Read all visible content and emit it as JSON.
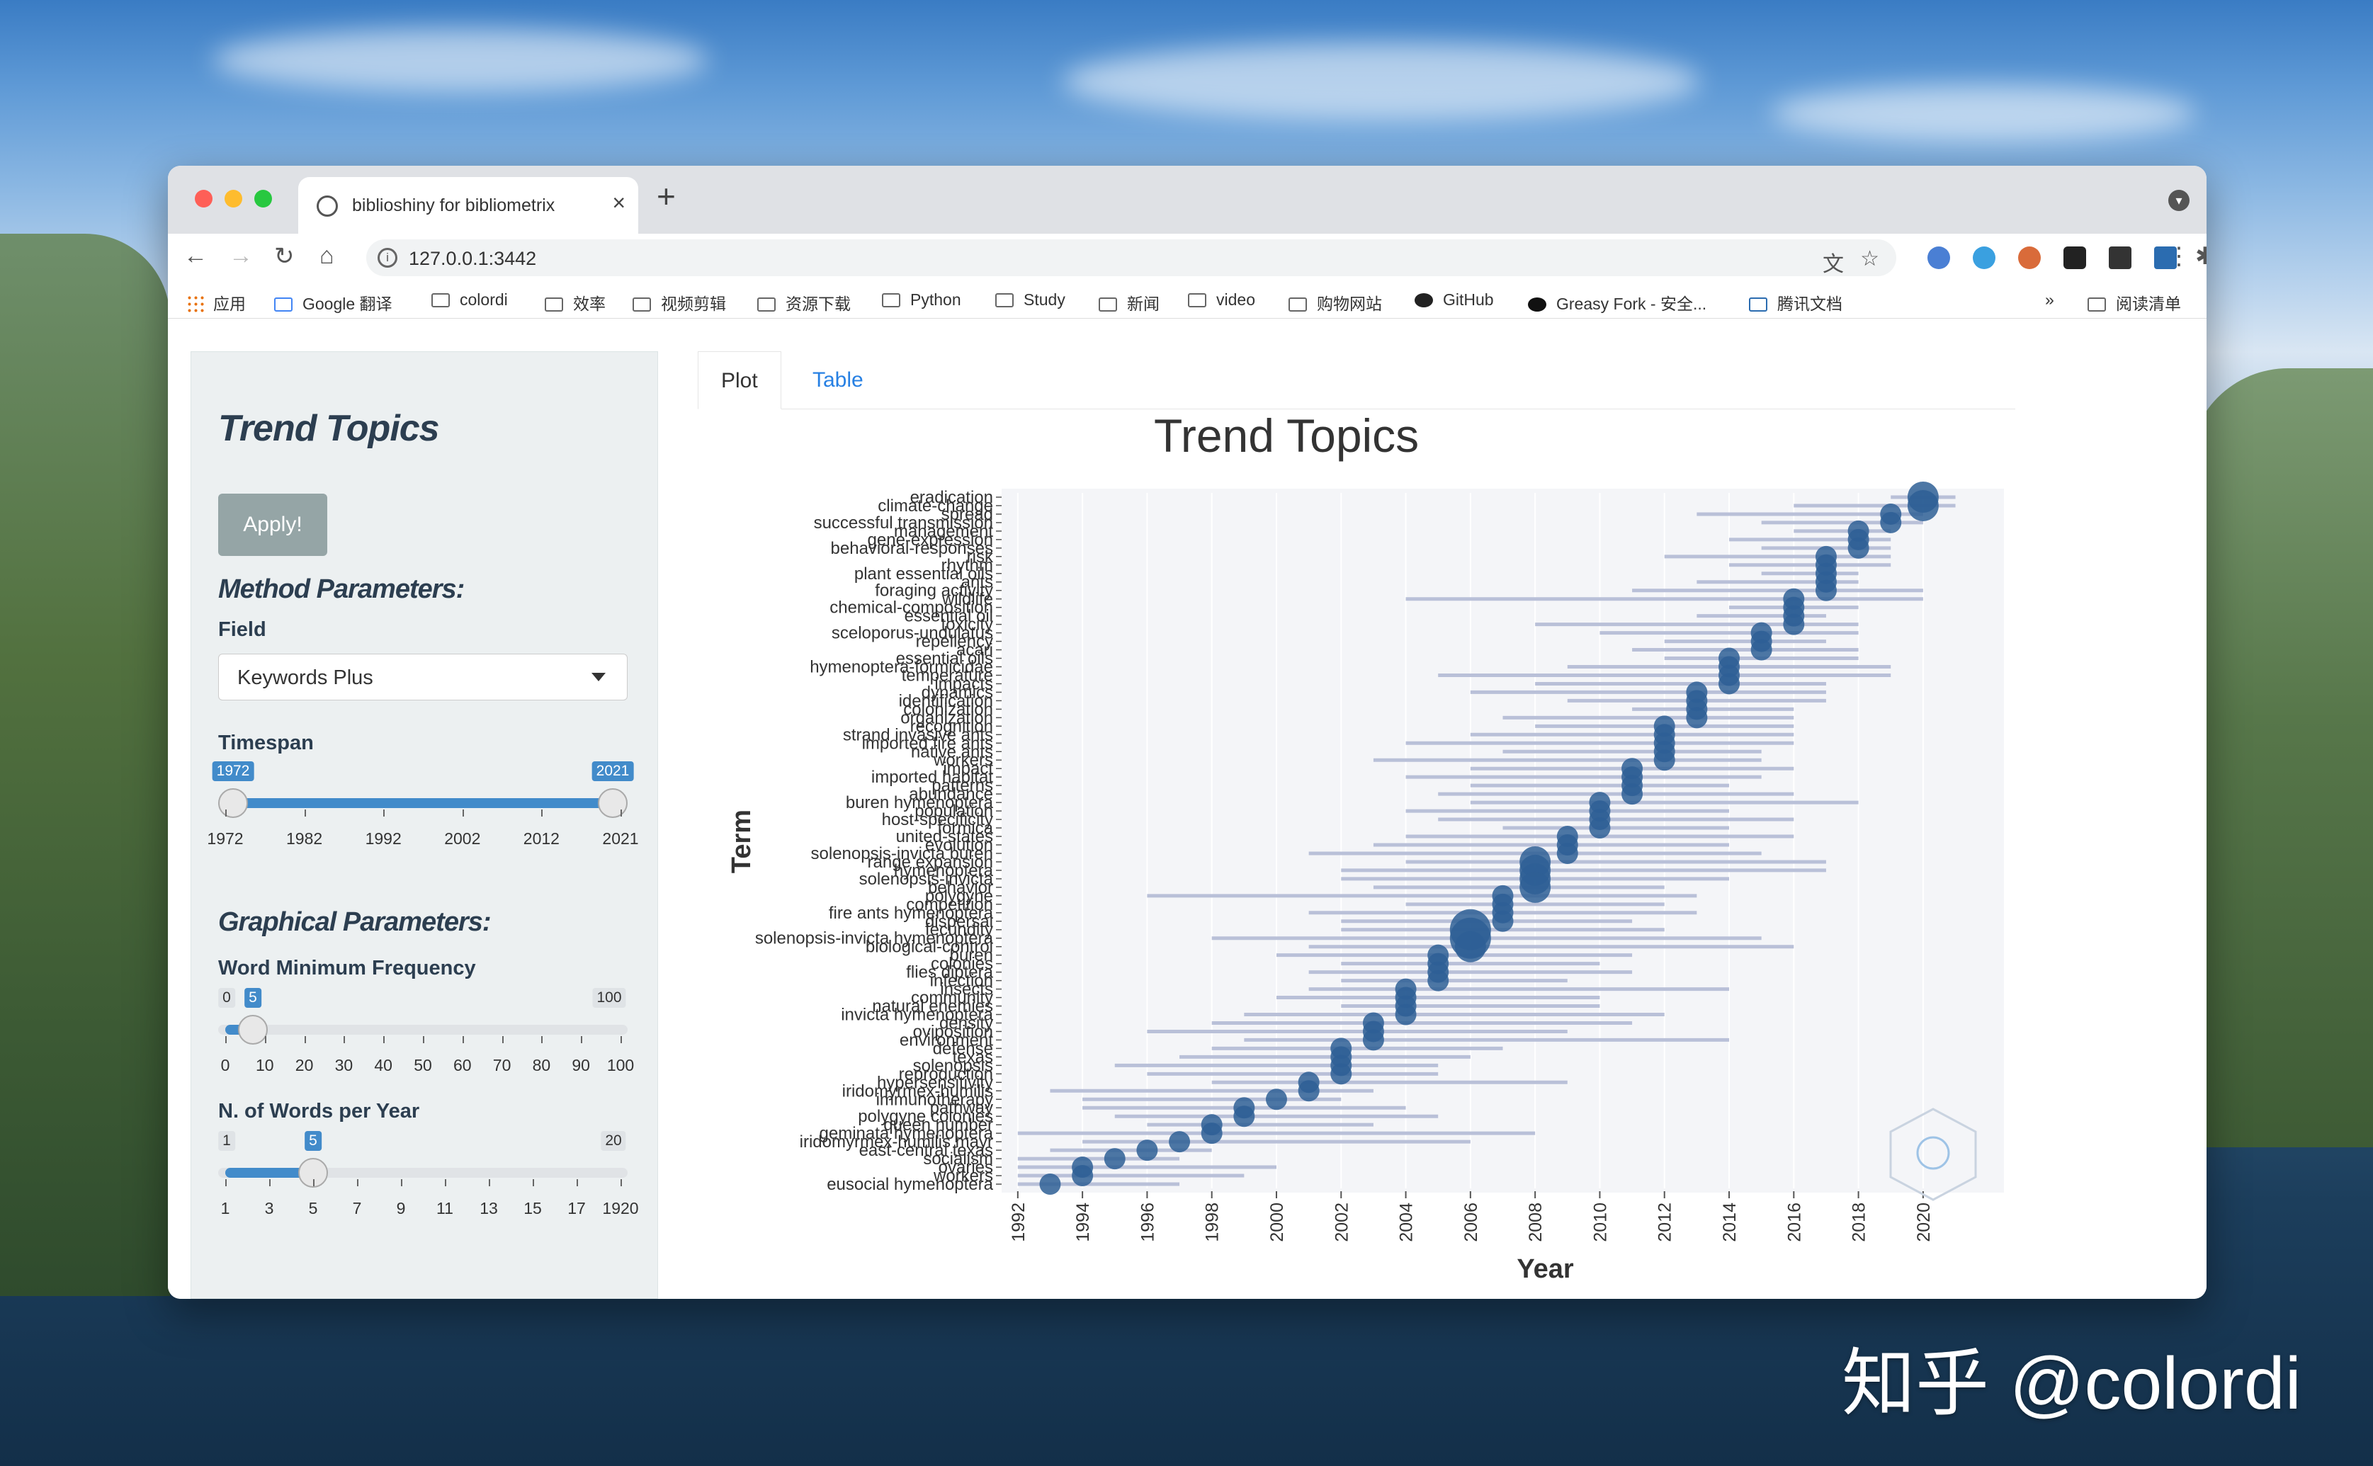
{
  "browser": {
    "tab_title": "biblioshiny for bibliometrix",
    "tab_close": "×",
    "new_tab": "+",
    "url": "127.0.0.1:3442",
    "nav": {
      "back": "←",
      "forward": "→",
      "reload": "↻",
      "home": "⌂",
      "info": "i",
      "translate": "文",
      "star": "☆",
      "puzzle": "✱",
      "kebab": "⋮"
    },
    "bookmarks": [
      "应用",
      "Google 翻译",
      "colordi",
      "效率",
      "视频剪辑",
      "资源下载",
      "Python",
      "Study",
      "新闻",
      "video",
      "购物网站",
      "GitHub",
      "Greasy Fork - 安全...",
      "腾讯文档"
    ],
    "more": "»",
    "reading_list": "阅读清单"
  },
  "sidebar": {
    "title": "Trend Topics",
    "apply": "Apply!",
    "method_title": "Method Parameters:",
    "field_label": "Field",
    "field_value": "Keywords Plus",
    "timespan_label": "Timespan",
    "timespan": {
      "min": 1972,
      "max": 2021,
      "from": "1972",
      "to": "2021",
      "ticks": [
        "1972",
        "1982",
        "1992",
        "2002",
        "2012",
        "2021"
      ]
    },
    "graphical_title": "Graphical Parameters:",
    "minfreq_label": "Word Minimum Frequency",
    "minfreq": {
      "min": "0",
      "max": "100",
      "value": "5",
      "ticks": [
        "0",
        "10",
        "20",
        "30",
        "40",
        "50",
        "60",
        "70",
        "80",
        "90",
        "100"
      ]
    },
    "words_label": "N. of Words per Year",
    "words": {
      "min": "1",
      "max": "20",
      "value": "5",
      "ticks": [
        "1",
        "3",
        "5",
        "7",
        "9",
        "11",
        "13",
        "15",
        "17",
        "1920"
      ]
    }
  },
  "tabs": {
    "plot": "Plot",
    "table": "Table"
  },
  "watermark": "知乎 @colordi",
  "chart_data": {
    "type": "scatter",
    "title": "Trend Topics",
    "xlabel": "Year",
    "ylabel": "Term",
    "xlim": [
      1991.5,
      2022.5
    ],
    "x_ticks": [
      "1992",
      "1994",
      "1996",
      "1998",
      "2000",
      "2002",
      "2004",
      "2006",
      "2008",
      "2010",
      "2012",
      "2014",
      "2016",
      "2018",
      "2020"
    ],
    "colors": {
      "point": "#2e5f95",
      "range": "#b9c0d8",
      "band": "#f4f5f8"
    },
    "terms": [
      {
        "term": "eradication",
        "median": 2020,
        "q1": 2019,
        "q3": 2021,
        "size": 2
      },
      {
        "term": "climate-change",
        "median": 2020,
        "q1": 2016,
        "q3": 2021,
        "size": 2
      },
      {
        "term": "spread",
        "median": 2019,
        "q1": 2013,
        "q3": 2020,
        "size": 1
      },
      {
        "term": "successful transmission",
        "median": 2019,
        "q1": 2015,
        "q3": 2020,
        "size": 1
      },
      {
        "term": "management",
        "median": 2018,
        "q1": 2016,
        "q3": 2019,
        "size": 1
      },
      {
        "term": "gene-expression",
        "median": 2018,
        "q1": 2014,
        "q3": 2019,
        "size": 1
      },
      {
        "term": "behavioral-responses",
        "median": 2018,
        "q1": 2015,
        "q3": 2019,
        "size": 1
      },
      {
        "term": "risk",
        "median": 2017,
        "q1": 2012,
        "q3": 2019,
        "size": 1
      },
      {
        "term": "rhythm",
        "median": 2017,
        "q1": 2014,
        "q3": 2019,
        "size": 1
      },
      {
        "term": "plant essential oils",
        "median": 2017,
        "q1": 2015,
        "q3": 2018,
        "size": 1
      },
      {
        "term": "ants",
        "median": 2017,
        "q1": 2013,
        "q3": 2018,
        "size": 1
      },
      {
        "term": "foraging activity",
        "median": 2017,
        "q1": 2011,
        "q3": 2020,
        "size": 1
      },
      {
        "term": "wildlife",
        "median": 2016,
        "q1": 2004,
        "q3": 2020,
        "size": 1
      },
      {
        "term": "chemical-composition",
        "median": 2016,
        "q1": 2014,
        "q3": 2018,
        "size": 1
      },
      {
        "term": "essential oil",
        "median": 2016,
        "q1": 2013,
        "q3": 2017,
        "size": 1
      },
      {
        "term": "toxicity",
        "median": 2016,
        "q1": 2008,
        "q3": 2018,
        "size": 1
      },
      {
        "term": "sceloporus-undulatus",
        "median": 2015,
        "q1": 2010,
        "q3": 2018,
        "size": 1
      },
      {
        "term": "repellency",
        "median": 2015,
        "q1": 2012,
        "q3": 2017,
        "size": 1
      },
      {
        "term": "acari",
        "median": 2015,
        "q1": 2011,
        "q3": 2018,
        "size": 1
      },
      {
        "term": "essential oils",
        "median": 2014,
        "q1": 2012,
        "q3": 2018,
        "size": 1
      },
      {
        "term": "hymenoptera-formicidae",
        "median": 2014,
        "q1": 2009,
        "q3": 2019,
        "size": 1
      },
      {
        "term": "temperature",
        "median": 2014,
        "q1": 2005,
        "q3": 2019,
        "size": 1
      },
      {
        "term": "impacts",
        "median": 2014,
        "q1": 2008,
        "q3": 2017,
        "size": 1
      },
      {
        "term": "dynamics",
        "median": 2013,
        "q1": 2006,
        "q3": 2017,
        "size": 1
      },
      {
        "term": "identification",
        "median": 2013,
        "q1": 2009,
        "q3": 2017,
        "size": 1
      },
      {
        "term": "colonization",
        "median": 2013,
        "q1": 2011,
        "q3": 2016,
        "size": 1
      },
      {
        "term": "organization",
        "median": 2013,
        "q1": 2007,
        "q3": 2016,
        "size": 1
      },
      {
        "term": "recognition",
        "median": 2012,
        "q1": 2008,
        "q3": 2016,
        "size": 1
      },
      {
        "term": "strand invasive ants",
        "median": 2012,
        "q1": 2006,
        "q3": 2016,
        "size": 1
      },
      {
        "term": "imported fire ants",
        "median": 2012,
        "q1": 2004,
        "q3": 2016,
        "size": 1
      },
      {
        "term": "native ants",
        "median": 2012,
        "q1": 2007,
        "q3": 2015,
        "size": 1
      },
      {
        "term": "workers",
        "median": 2012,
        "q1": 2003,
        "q3": 2015,
        "size": 1
      },
      {
        "term": "impact",
        "median": 2011,
        "q1": 2006,
        "q3": 2016,
        "size": 1
      },
      {
        "term": "imported habitat",
        "median": 2011,
        "q1": 2004,
        "q3": 2015,
        "size": 1
      },
      {
        "term": "patterns",
        "median": 2011,
        "q1": 2006,
        "q3": 2014,
        "size": 1
      },
      {
        "term": "abundance",
        "median": 2011,
        "q1": 2005,
        "q3": 2016,
        "size": 1
      },
      {
        "term": "buren hymenoptera",
        "median": 2010,
        "q1": 2006,
        "q3": 2018,
        "size": 1
      },
      {
        "term": "population",
        "median": 2010,
        "q1": 2004,
        "q3": 2014,
        "size": 1
      },
      {
        "term": "host-specificity",
        "median": 2010,
        "q1": 2005,
        "q3": 2016,
        "size": 1
      },
      {
        "term": "formica",
        "median": 2010,
        "q1": 2007,
        "q3": 2014,
        "size": 1
      },
      {
        "term": "united-states",
        "median": 2009,
        "q1": 2004,
        "q3": 2016,
        "size": 1
      },
      {
        "term": "evolution",
        "median": 2009,
        "q1": 2003,
        "q3": 2014,
        "size": 1
      },
      {
        "term": "solenopsis-invicta buren",
        "median": 2009,
        "q1": 2001,
        "q3": 2015,
        "size": 1
      },
      {
        "term": "range expansion",
        "median": 2008,
        "q1": 2004,
        "q3": 2017,
        "size": 2
      },
      {
        "term": "hymenoptera",
        "median": 2008,
        "q1": 2002,
        "q3": 2017,
        "size": 2
      },
      {
        "term": "solenopsis-invicta",
        "median": 2008,
        "q1": 2002,
        "q3": 2014,
        "size": 2
      },
      {
        "term": "behavior",
        "median": 2008,
        "q1": 2003,
        "q3": 2012,
        "size": 2
      },
      {
        "term": "polygyne",
        "median": 2007,
        "q1": 1996,
        "q3": 2013,
        "size": 1
      },
      {
        "term": "competition",
        "median": 2007,
        "q1": 2004,
        "q3": 2012,
        "size": 1
      },
      {
        "term": "fire ants hymenoptera",
        "median": 2007,
        "q1": 2001,
        "q3": 2013,
        "size": 1
      },
      {
        "term": "dispersal",
        "median": 2007,
        "q1": 2002,
        "q3": 2011,
        "size": 1
      },
      {
        "term": "fecundity",
        "median": 2006,
        "q1": 2002,
        "q3": 2012,
        "size": 3
      },
      {
        "term": "solenopsis-invicta hymenoptera",
        "median": 2006,
        "q1": 1998,
        "q3": 2015,
        "size": 3
      },
      {
        "term": "biological-control",
        "median": 2006,
        "q1": 2001,
        "q3": 2016,
        "size": 2
      },
      {
        "term": "buren",
        "median": 2005,
        "q1": 2000,
        "q3": 2011,
        "size": 1
      },
      {
        "term": "colonies",
        "median": 2005,
        "q1": 2002,
        "q3": 2010,
        "size": 1
      },
      {
        "term": "flies diptera",
        "median": 2005,
        "q1": 2001,
        "q3": 2011,
        "size": 1
      },
      {
        "term": "infection",
        "median": 2005,
        "q1": 2002,
        "q3": 2009,
        "size": 1
      },
      {
        "term": "insects",
        "median": 2004,
        "q1": 2001,
        "q3": 2014,
        "size": 1
      },
      {
        "term": "community",
        "median": 2004,
        "q1": 2000,
        "q3": 2010,
        "size": 1
      },
      {
        "term": "natural enemies",
        "median": 2004,
        "q1": 2002,
        "q3": 2010,
        "size": 1
      },
      {
        "term": "invicta hymenoptera",
        "median": 2004,
        "q1": 1999,
        "q3": 2012,
        "size": 1
      },
      {
        "term": "density",
        "median": 2003,
        "q1": 1998,
        "q3": 2011,
        "size": 1
      },
      {
        "term": "oviposition",
        "median": 2003,
        "q1": 1996,
        "q3": 2009,
        "size": 1
      },
      {
        "term": "environment",
        "median": 2003,
        "q1": 1999,
        "q3": 2014,
        "size": 1
      },
      {
        "term": "defense",
        "median": 2002,
        "q1": 1998,
        "q3": 2007,
        "size": 1
      },
      {
        "term": "texas",
        "median": 2002,
        "q1": 1997,
        "q3": 2006,
        "size": 1
      },
      {
        "term": "solenopsis",
        "median": 2002,
        "q1": 1995,
        "q3": 2005,
        "size": 1
      },
      {
        "term": "reproduction",
        "median": 2002,
        "q1": 1996,
        "q3": 2005,
        "size": 1
      },
      {
        "term": "hypersensitivity",
        "median": 2001,
        "q1": 1998,
        "q3": 2009,
        "size": 1
      },
      {
        "term": "iridomyrmex-humilis",
        "median": 2001,
        "q1": 1993,
        "q3": 2003,
        "size": 1
      },
      {
        "term": "immunotherapy",
        "median": 2000,
        "q1": 1994,
        "q3": 2002,
        "size": 1
      },
      {
        "term": "pathway",
        "median": 1999,
        "q1": 1994,
        "q3": 2004,
        "size": 1
      },
      {
        "term": "polygyne colonies",
        "median": 1999,
        "q1": 1995,
        "q3": 2005,
        "size": 1
      },
      {
        "term": "queen number",
        "median": 1998,
        "q1": 1996,
        "q3": 2003,
        "size": 1
      },
      {
        "term": "geminata hymenoptera",
        "median": 1998,
        "q1": 1992,
        "q3": 2008,
        "size": 1
      },
      {
        "term": "iridomyrmex-humilis mayr",
        "median": 1997,
        "q1": 1994,
        "q3": 2006,
        "size": 1
      },
      {
        "term": "east-central texas",
        "median": 1996,
        "q1": 1993,
        "q3": 1998,
        "size": 1
      },
      {
        "term": "socialism",
        "median": 1995,
        "q1": 1992,
        "q3": 1997,
        "size": 1
      },
      {
        "term": "ovaries",
        "median": 1994,
        "q1": 1992,
        "q3": 2000,
        "size": 1
      },
      {
        "term": "workers",
        "median": 1994,
        "q1": 1992,
        "q3": 1999,
        "size": 1
      },
      {
        "term": "eusocial hymenoptera",
        "median": 1993,
        "q1": 1992,
        "q3": 1997,
        "size": 1
      }
    ]
  }
}
